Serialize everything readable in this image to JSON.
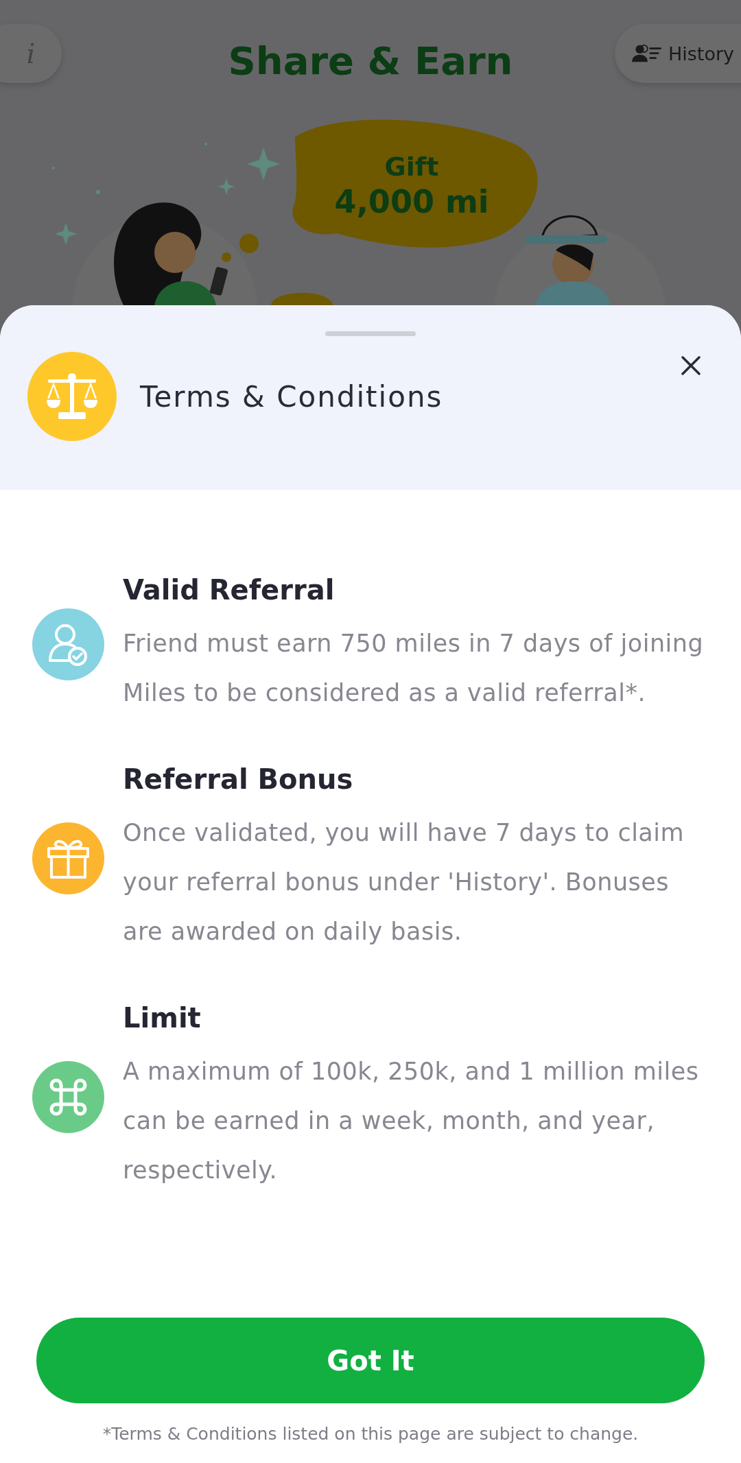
{
  "top_bar": {
    "info_button": "i",
    "title": "Share & Earn",
    "history_button": "History"
  },
  "promo": {
    "lines": [
      "Gift",
      "4,000 mi"
    ]
  },
  "sheet": {
    "title": "Terms & Conditions",
    "items": [
      {
        "kind": "user-check",
        "color": "#86d3e2",
        "title": "Valid Referral",
        "text": "Friend must earn 750 miles in 7 days of joining Miles to be considered as a valid referral*."
      },
      {
        "kind": "gift",
        "color": "#fcb52f",
        "title": "Referral Bonus",
        "text": "Once validated, you will have 7 days to claim your referral bonus under 'History'. Bonuses are awarded on daily basis."
      },
      {
        "kind": "command",
        "color": "#6acb88",
        "title": "Limit",
        "text": "A maximum of 100k, 250k, and 1 million miles can be earned in a week, month, and year, respectively."
      }
    ],
    "button": "Got It",
    "footnote": "*Terms & Conditions listed on this page are subject to change."
  }
}
